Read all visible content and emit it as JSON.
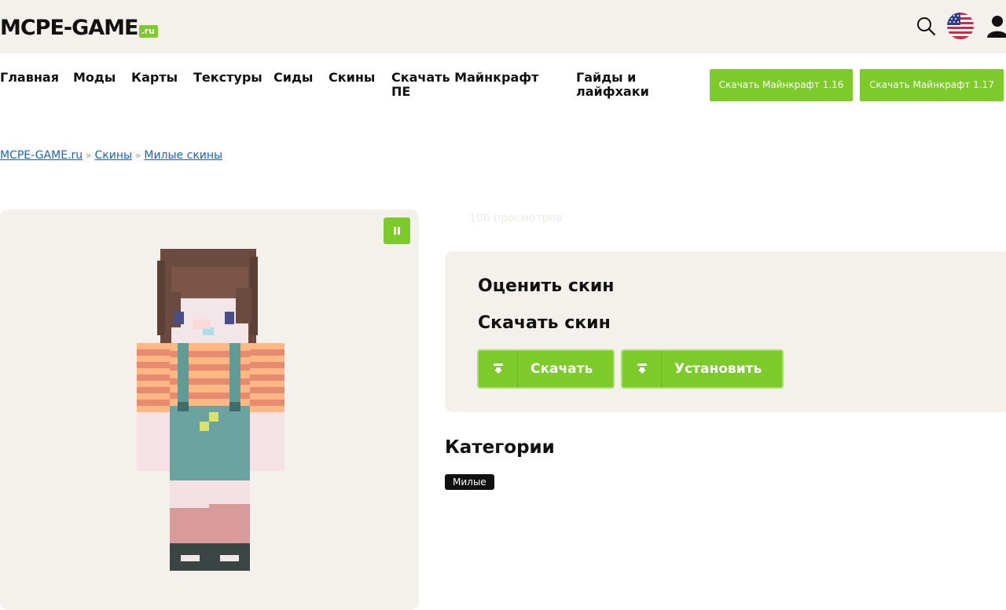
{
  "header": {
    "logo_main": "MCPE-GAME",
    "logo_suffix": ".ru",
    "icons": [
      "search-icon",
      "us-flag-icon",
      "user-icon"
    ]
  },
  "nav": {
    "items": [
      "Главная",
      "Моды",
      "Карты",
      "Текстуры",
      "Сиды",
      "Скины",
      "Скачать Майнкрафт ПЕ",
      "Гайды и лайфхаки"
    ],
    "download_buttons": [
      "Скачать Майнкрафт 1.16",
      "Скачать Майнкрафт 1.17"
    ]
  },
  "breadcrumb": {
    "items": [
      "MCPE-GAME.ru",
      "Скины",
      "Милые скины"
    ],
    "separator": "»"
  },
  "preview": {
    "pause_icon": "pause-icon"
  },
  "views": "106 просмотров",
  "rate_panel": {
    "rate_title": "Оценить скин",
    "download_title": "Скачать скин",
    "download_button": "Скачать",
    "install_button": "Установить"
  },
  "categories": {
    "title": "Категории",
    "tags": [
      "Милые"
    ]
  },
  "colors": {
    "accent": "#7ccb2b",
    "panel_bg": "#f4f1ec",
    "link": "#1a5fd6"
  }
}
